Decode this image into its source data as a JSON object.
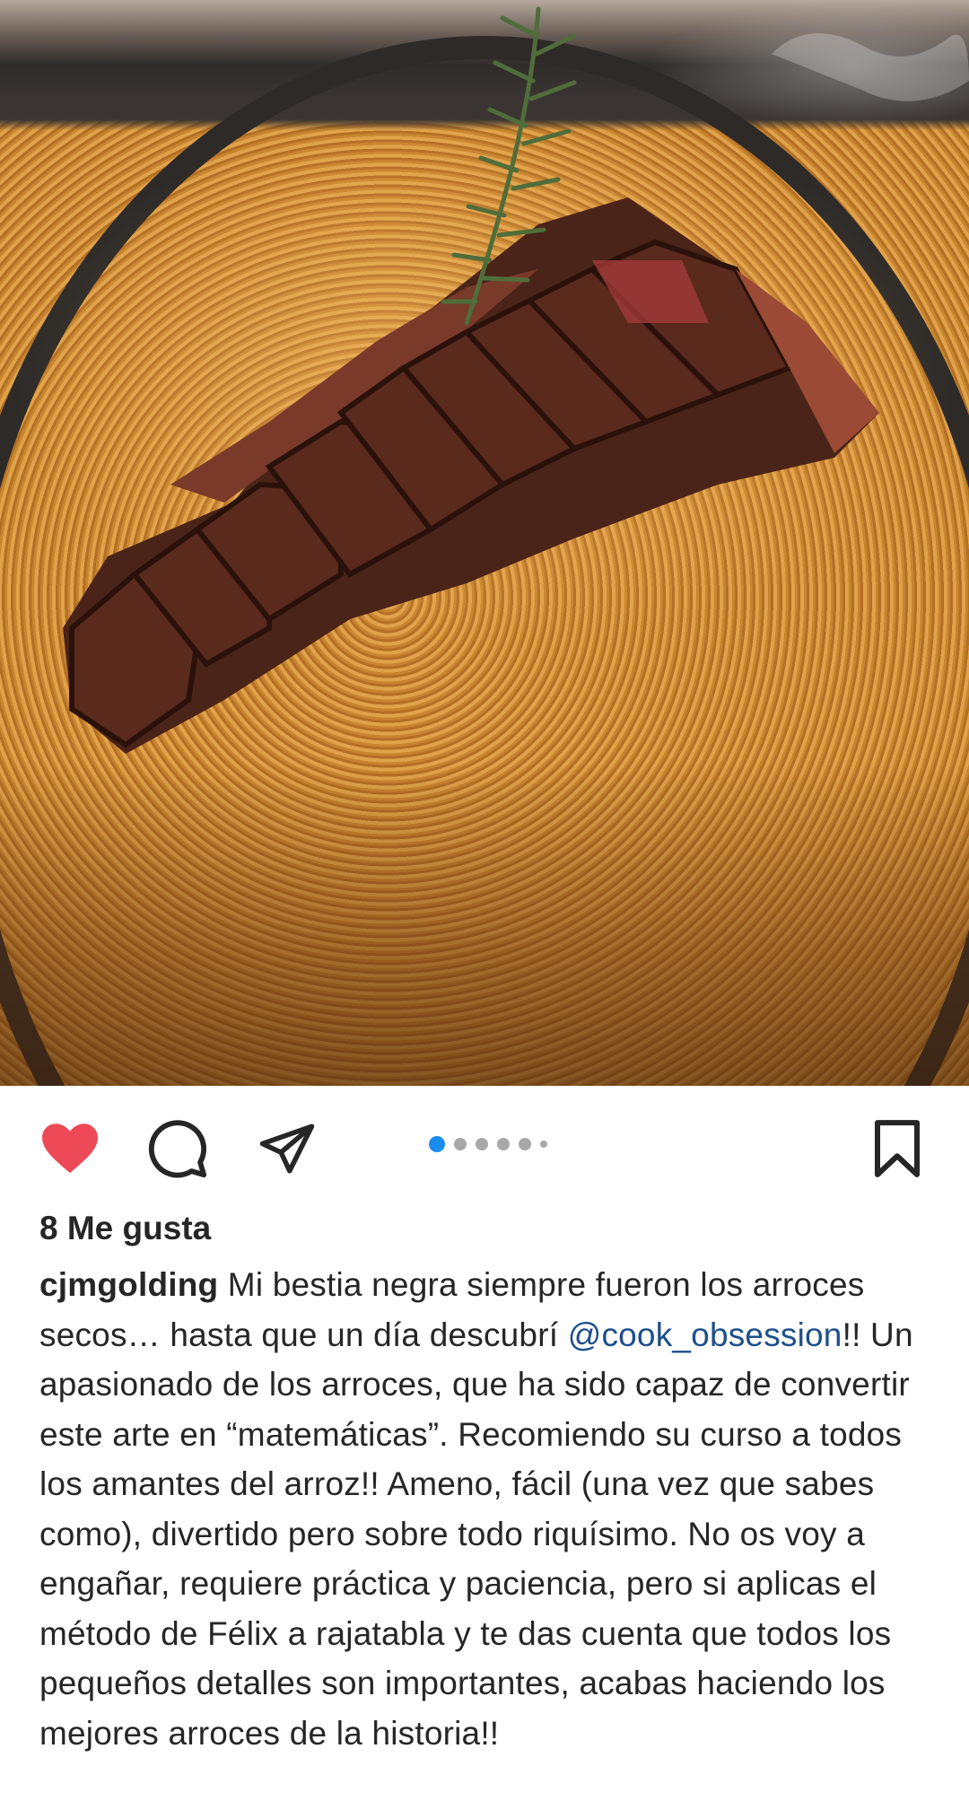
{
  "post": {
    "photo": {
      "description_icon": "food-photo"
    },
    "actions": {
      "like_icon": "heart-filled-icon",
      "comment_icon": "comment-icon",
      "share_icon": "send-icon",
      "save_icon": "bookmark-icon",
      "liked": true,
      "like_color": "#ed4956"
    },
    "carousel": {
      "total_visible_dots": 6,
      "active_index": 0,
      "active_color": "#1a8cef"
    },
    "likes_text": "8 Me gusta",
    "caption": {
      "username": "cjmgolding",
      "text_before_mention": " Mi bestia negra siempre fueron los arroces secos… hasta que un día descubrí ",
      "mention": "@cook_obsession",
      "text_after_mention": "!! Un apasionado de los arroces, que ha sido capaz de convertir este arte en “matemáticas”. Recomiendo su curso a todos los amantes del arroz!! Ameno, fácil (una vez que sabes como), divertido pero sobre todo riquísimo. No os voy a engañar, requiere práctica y paciencia, pero si aplicas el método de Félix a rajatabla y te das cuenta que todos los pequeños detalles son importantes, acabas haciendo los mejores arroces de la historia!!"
    }
  }
}
